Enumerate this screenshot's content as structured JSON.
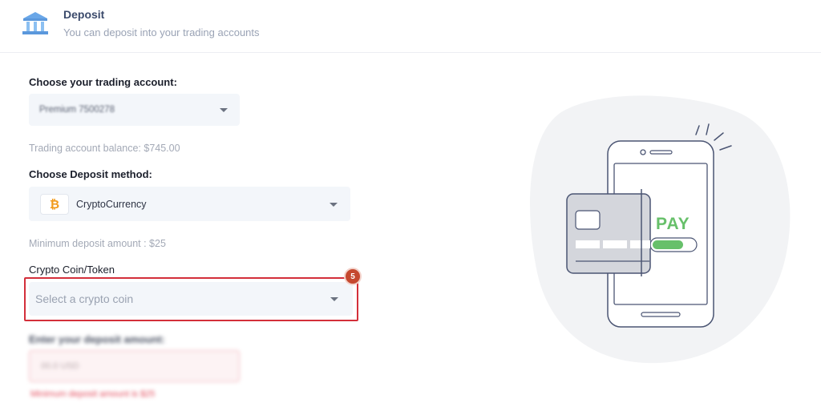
{
  "header": {
    "title": "Deposit",
    "subtitle": "You can deposit into your trading accounts"
  },
  "form": {
    "account_label": "Choose your trading account:",
    "account_value": "Premium 7500278",
    "balance_text": "Trading account balance: $745.00",
    "method_label": "Choose Deposit method:",
    "method_value": "CryptoCurrency",
    "method_icon": "bitcoin-icon",
    "min_deposit_text": "Minimum deposit amount : $25",
    "coin_label": "Crypto Coin/Token",
    "coin_placeholder": "Select a crypto coin",
    "amount_label": "Enter your deposit amount:",
    "amount_placeholder": "00.0 USD",
    "amount_error": "Minimum deposit amount is $25"
  },
  "annotation": {
    "step_number": "5",
    "highlight_color": "#d32f3a"
  },
  "illustration": {
    "pay_text": "PAY",
    "accent_color": "#67c06a"
  }
}
